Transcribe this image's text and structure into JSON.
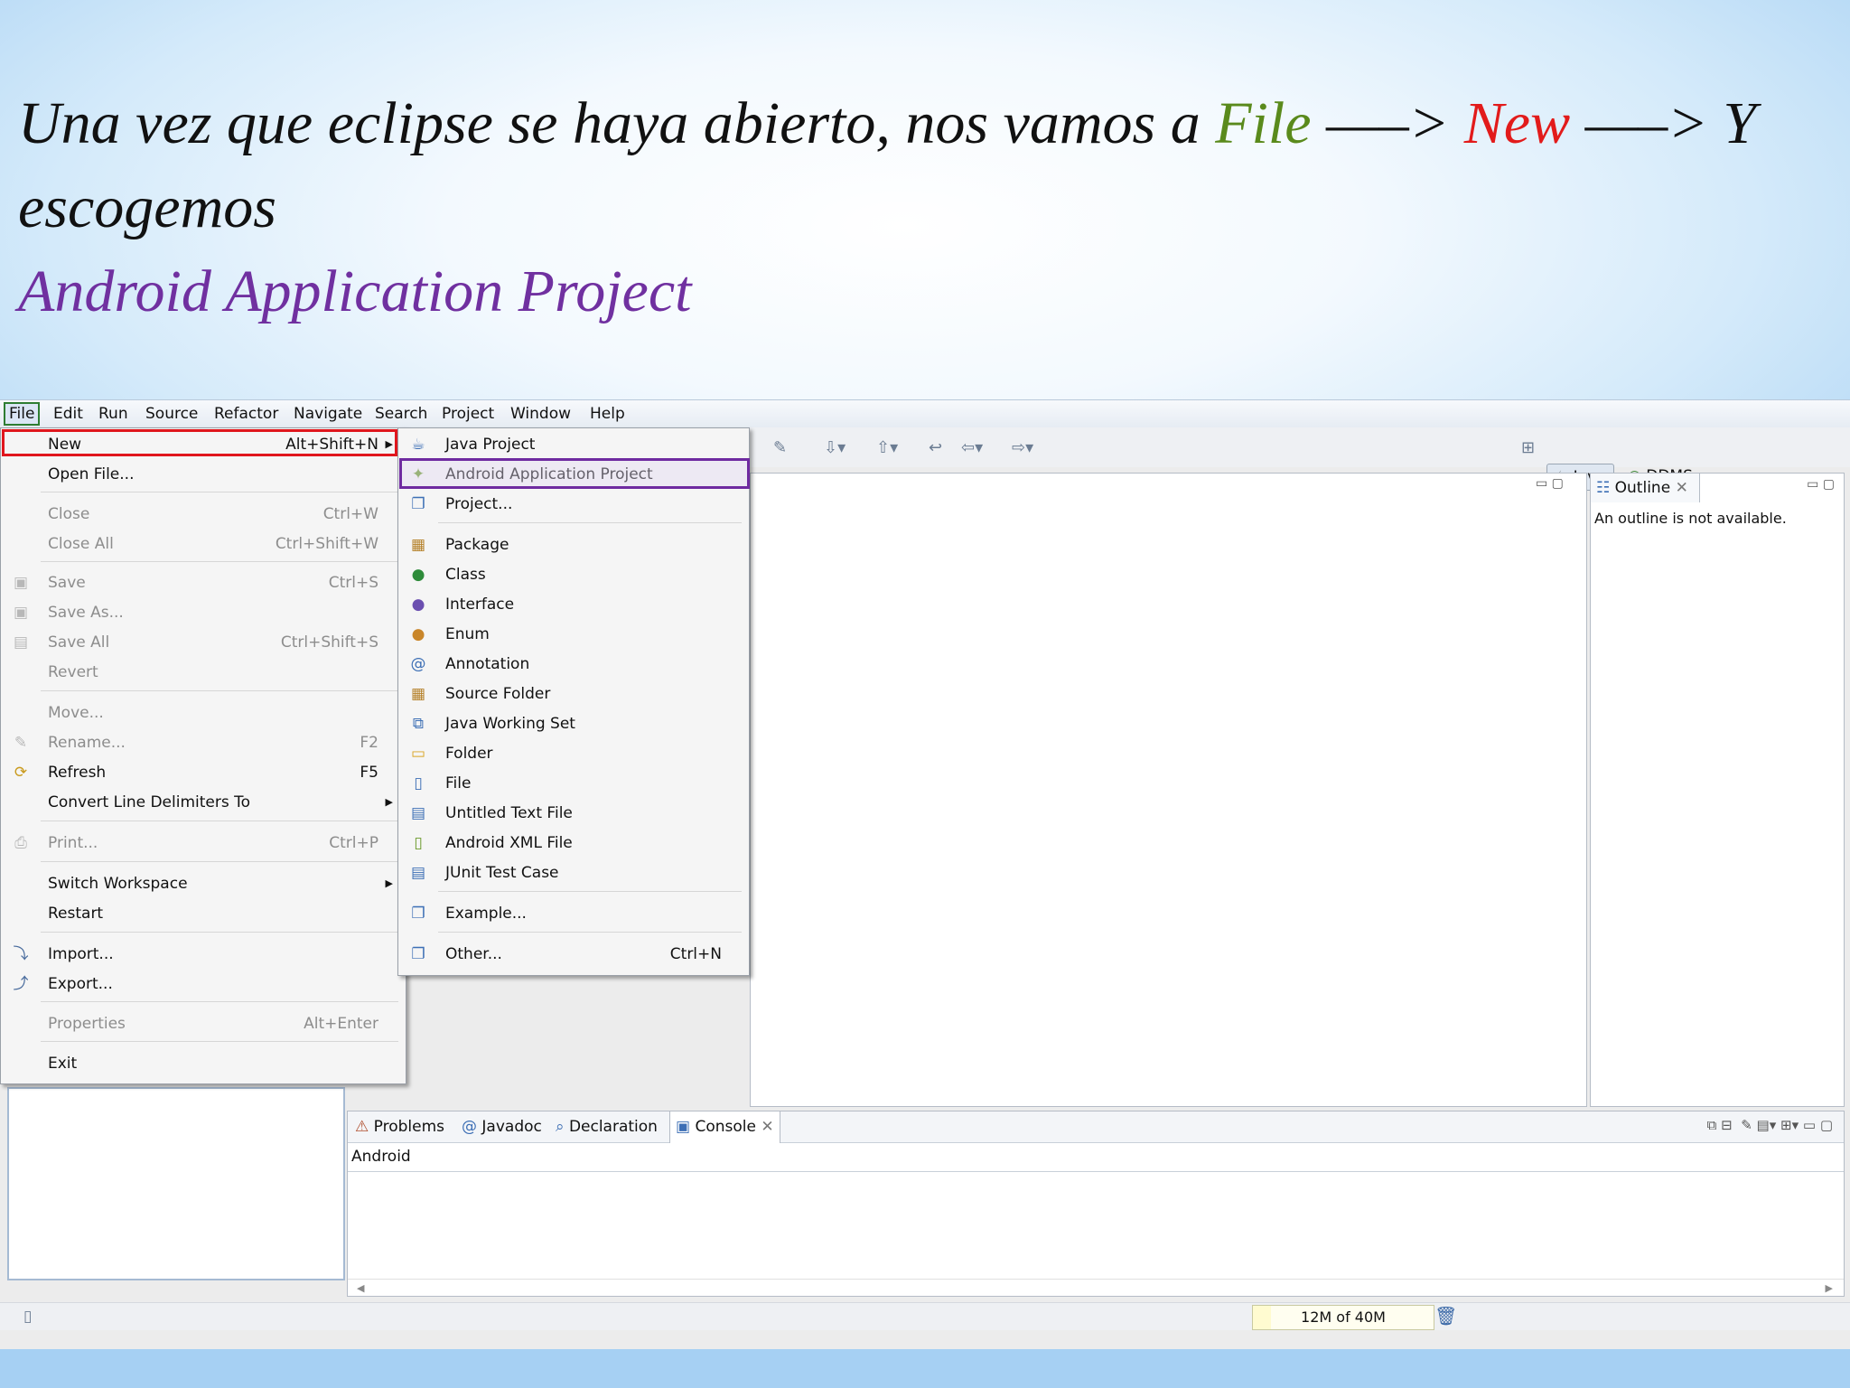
{
  "slide": {
    "title_part1": "Una vez que eclipse se haya abierto, nos vamos a ",
    "title_file": "File",
    "title_arrow1": " —–> ",
    "title_new": "New",
    "title_arrow2": " —–> Y escogemos ",
    "title_project": "Android Application Project",
    "colors": {
      "file": "#5a8a1c",
      "new": "#e21b1b",
      "project": "#7030a0"
    }
  },
  "menubar": [
    "File",
    "Edit",
    "Run",
    "Source",
    "Refactor",
    "Navigate",
    "Search",
    "Project",
    "Window",
    "Help"
  ],
  "perspectives": {
    "java": "Java",
    "ddms": "DDMS"
  },
  "file_menu": [
    {
      "label": "New",
      "accel": "Alt+Shift+N",
      "icon": "",
      "submenu": true
    },
    {
      "label": "Open File...",
      "accel": "",
      "icon": ""
    },
    {
      "label": "Close",
      "accel": "Ctrl+W",
      "disabled": true
    },
    {
      "label": "Close All",
      "accel": "Ctrl+Shift+W",
      "disabled": true
    },
    {
      "label": "Save",
      "accel": "Ctrl+S",
      "disabled": true,
      "icon": "save-icon"
    },
    {
      "label": "Save As...",
      "accel": "",
      "disabled": true,
      "icon": "save-as-icon"
    },
    {
      "label": "Save All",
      "accel": "Ctrl+Shift+S",
      "disabled": true,
      "icon": "save-all-icon"
    },
    {
      "label": "Revert",
      "accel": "",
      "disabled": true
    },
    {
      "label": "Move...",
      "accel": "",
      "disabled": true
    },
    {
      "label": "Rename...",
      "accel": "F2",
      "disabled": true,
      "icon": "rename-icon"
    },
    {
      "label": "Refresh",
      "accel": "F5",
      "icon": "refresh-icon"
    },
    {
      "label": "Convert Line Delimiters To",
      "accel": "",
      "submenu": true
    },
    {
      "label": "Print...",
      "accel": "Ctrl+P",
      "disabled": true,
      "icon": "print-icon"
    },
    {
      "label": "Switch Workspace",
      "accel": "",
      "submenu": true
    },
    {
      "label": "Restart",
      "accel": ""
    },
    {
      "label": "Import...",
      "accel": "",
      "icon": "import-icon"
    },
    {
      "label": "Export...",
      "accel": "",
      "icon": "export-icon"
    },
    {
      "label": "Properties",
      "accel": "Alt+Enter",
      "disabled": true
    },
    {
      "label": "Exit",
      "accel": ""
    }
  ],
  "new_menu": [
    {
      "label": "Java Project",
      "accel": ""
    },
    {
      "label": "Android Application Project",
      "accel": ""
    },
    {
      "label": "Project...",
      "accel": ""
    },
    {
      "label": "Package",
      "accel": ""
    },
    {
      "label": "Class",
      "accel": ""
    },
    {
      "label": "Interface",
      "accel": ""
    },
    {
      "label": "Enum",
      "accel": ""
    },
    {
      "label": "Annotation",
      "accel": ""
    },
    {
      "label": "Source Folder",
      "accel": ""
    },
    {
      "label": "Java Working Set",
      "accel": ""
    },
    {
      "label": "Folder",
      "accel": ""
    },
    {
      "label": "File",
      "accel": ""
    },
    {
      "label": "Untitled Text File",
      "accel": ""
    },
    {
      "label": "Android XML File",
      "accel": ""
    },
    {
      "label": "JUnit Test Case",
      "accel": ""
    },
    {
      "label": "Example...",
      "accel": ""
    },
    {
      "label": "Other...",
      "accel": "Ctrl+N"
    }
  ],
  "outline": {
    "tab": "Outline",
    "message": "An outline is not available."
  },
  "bottom_tabs": [
    "Problems",
    "Javadoc",
    "Declaration",
    "Console"
  ],
  "console_label": "Android",
  "status": {
    "heap": "12M of 40M"
  }
}
